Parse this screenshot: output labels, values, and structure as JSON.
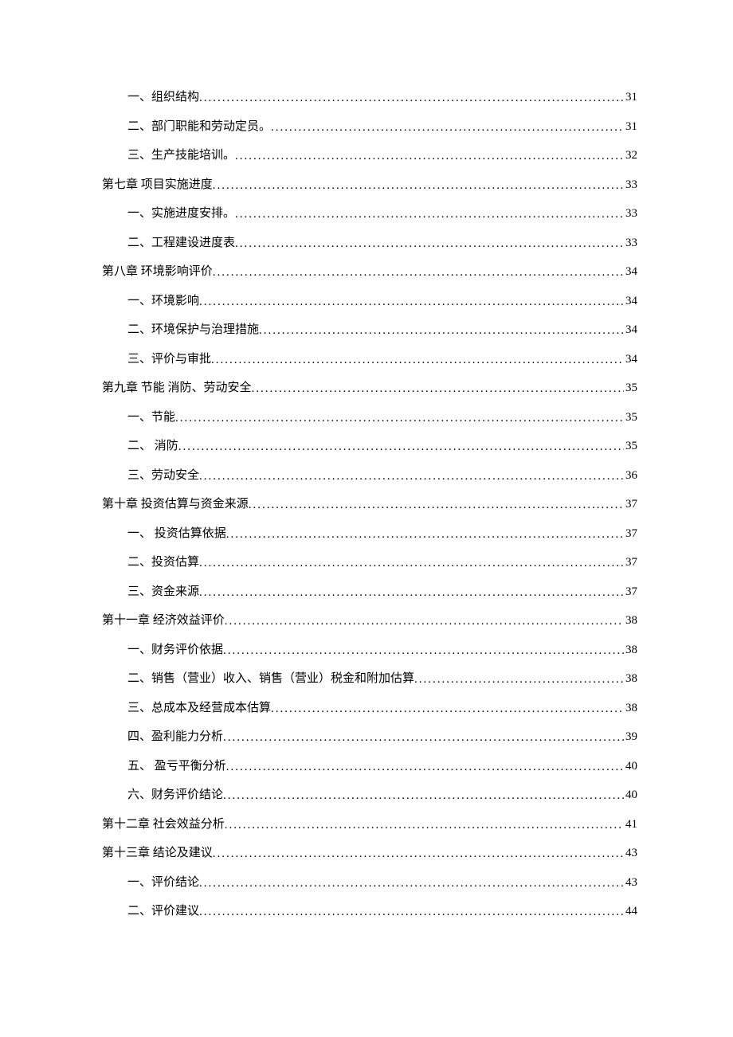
{
  "toc": [
    {
      "label": "一、组织结构",
      "page": "31",
      "level": 1
    },
    {
      "label": "二、部门职能和劳动定员。",
      "page": "31",
      "level": 1
    },
    {
      "label": "三、生产技能培训。",
      "page": "32",
      "level": 1
    },
    {
      "label": "第七章  项目实施进度",
      "page": "33",
      "level": 0
    },
    {
      "label": "一、实施进度安排。",
      "page": "33",
      "level": 1
    },
    {
      "label": "二、工程建设进度表",
      "page": "33",
      "level": 1
    },
    {
      "label": "第八章  环境影响评价",
      "page": "34",
      "level": 0
    },
    {
      "label": "一、环境影响",
      "page": "34",
      "level": 1
    },
    {
      "label": "二、环境保护与治理措施",
      "page": "34",
      "level": 1
    },
    {
      "label": "三、评价与审批",
      "page": "34",
      "level": 1
    },
    {
      "label": "第九章  节能 消防、劳动安全",
      "page": "35",
      "level": 0
    },
    {
      "label": "一、节能",
      "page": "35",
      "level": 1
    },
    {
      "label": "二、 消防",
      "page": "35",
      "level": 1
    },
    {
      "label": "三、劳动安全",
      "page": "36",
      "level": 1
    },
    {
      "label": "第十章 投资估算与资金来源",
      "page": "37",
      "level": 0
    },
    {
      "label": "一、 投资估算依据",
      "page": "37",
      "level": 1
    },
    {
      "label": "二、投资估算",
      "page": "37",
      "level": 1
    },
    {
      "label": "三、资金来源",
      "page": "37",
      "level": 1
    },
    {
      "label": "第十一章  经济效益评价",
      "page": "38",
      "level": 0
    },
    {
      "label": "一、财务评价依据",
      "page": "38",
      "level": 1
    },
    {
      "label": "二、销售（营业）收入、销售（营业）税金和附加估算",
      "page": "38",
      "level": 1
    },
    {
      "label": "三、总成本及经营成本估算",
      "page": "38",
      "level": 1
    },
    {
      "label": "四、盈利能力分析",
      "page": "39",
      "level": 1
    },
    {
      "label": "五、 盈亏平衡分析",
      "page": "40",
      "level": 1
    },
    {
      "label": "六、财务评价结论",
      "page": "40",
      "level": 1
    },
    {
      "label": "第十二章  社会效益分析",
      "page": "41",
      "level": 0
    },
    {
      "label": "第十三章  结论及建议",
      "page": "43",
      "level": 0
    },
    {
      "label": "一、评价结论",
      "page": "43",
      "level": 1
    },
    {
      "label": "二、评价建议",
      "page": "44",
      "level": 1
    }
  ]
}
